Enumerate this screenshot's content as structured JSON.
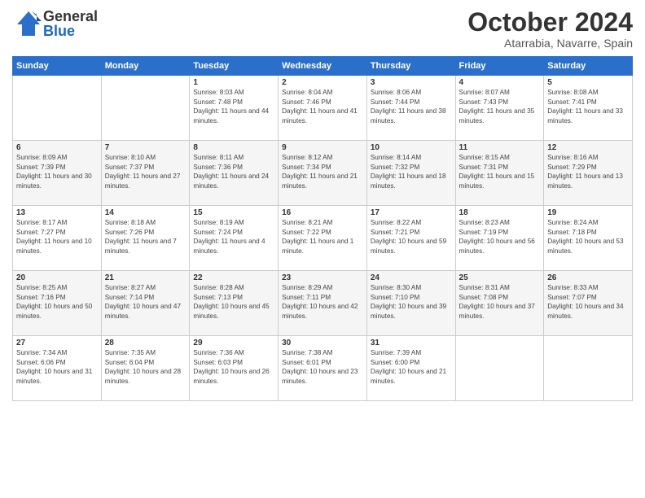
{
  "logo": {
    "general": "General",
    "blue": "Blue"
  },
  "title": {
    "month": "October 2024",
    "location": "Atarrabia, Navarre, Spain"
  },
  "headers": [
    "Sunday",
    "Monday",
    "Tuesday",
    "Wednesday",
    "Thursday",
    "Friday",
    "Saturday"
  ],
  "weeks": [
    [
      {
        "day": "",
        "info": ""
      },
      {
        "day": "",
        "info": ""
      },
      {
        "day": "1",
        "info": "Sunrise: 8:03 AM\nSunset: 7:48 PM\nDaylight: 11 hours and 44 minutes."
      },
      {
        "day": "2",
        "info": "Sunrise: 8:04 AM\nSunset: 7:46 PM\nDaylight: 11 hours and 41 minutes."
      },
      {
        "day": "3",
        "info": "Sunrise: 8:06 AM\nSunset: 7:44 PM\nDaylight: 11 hours and 38 minutes."
      },
      {
        "day": "4",
        "info": "Sunrise: 8:07 AM\nSunset: 7:43 PM\nDaylight: 11 hours and 35 minutes."
      },
      {
        "day": "5",
        "info": "Sunrise: 8:08 AM\nSunset: 7:41 PM\nDaylight: 11 hours and 33 minutes."
      }
    ],
    [
      {
        "day": "6",
        "info": "Sunrise: 8:09 AM\nSunset: 7:39 PM\nDaylight: 11 hours and 30 minutes."
      },
      {
        "day": "7",
        "info": "Sunrise: 8:10 AM\nSunset: 7:37 PM\nDaylight: 11 hours and 27 minutes."
      },
      {
        "day": "8",
        "info": "Sunrise: 8:11 AM\nSunset: 7:36 PM\nDaylight: 11 hours and 24 minutes."
      },
      {
        "day": "9",
        "info": "Sunrise: 8:12 AM\nSunset: 7:34 PM\nDaylight: 11 hours and 21 minutes."
      },
      {
        "day": "10",
        "info": "Sunrise: 8:14 AM\nSunset: 7:32 PM\nDaylight: 11 hours and 18 minutes."
      },
      {
        "day": "11",
        "info": "Sunrise: 8:15 AM\nSunset: 7:31 PM\nDaylight: 11 hours and 15 minutes."
      },
      {
        "day": "12",
        "info": "Sunrise: 8:16 AM\nSunset: 7:29 PM\nDaylight: 11 hours and 13 minutes."
      }
    ],
    [
      {
        "day": "13",
        "info": "Sunrise: 8:17 AM\nSunset: 7:27 PM\nDaylight: 11 hours and 10 minutes."
      },
      {
        "day": "14",
        "info": "Sunrise: 8:18 AM\nSunset: 7:26 PM\nDaylight: 11 hours and 7 minutes."
      },
      {
        "day": "15",
        "info": "Sunrise: 8:19 AM\nSunset: 7:24 PM\nDaylight: 11 hours and 4 minutes."
      },
      {
        "day": "16",
        "info": "Sunrise: 8:21 AM\nSunset: 7:22 PM\nDaylight: 11 hours and 1 minute."
      },
      {
        "day": "17",
        "info": "Sunrise: 8:22 AM\nSunset: 7:21 PM\nDaylight: 10 hours and 59 minutes."
      },
      {
        "day": "18",
        "info": "Sunrise: 8:23 AM\nSunset: 7:19 PM\nDaylight: 10 hours and 56 minutes."
      },
      {
        "day": "19",
        "info": "Sunrise: 8:24 AM\nSunset: 7:18 PM\nDaylight: 10 hours and 53 minutes."
      }
    ],
    [
      {
        "day": "20",
        "info": "Sunrise: 8:25 AM\nSunset: 7:16 PM\nDaylight: 10 hours and 50 minutes."
      },
      {
        "day": "21",
        "info": "Sunrise: 8:27 AM\nSunset: 7:14 PM\nDaylight: 10 hours and 47 minutes."
      },
      {
        "day": "22",
        "info": "Sunrise: 8:28 AM\nSunset: 7:13 PM\nDaylight: 10 hours and 45 minutes."
      },
      {
        "day": "23",
        "info": "Sunrise: 8:29 AM\nSunset: 7:11 PM\nDaylight: 10 hours and 42 minutes."
      },
      {
        "day": "24",
        "info": "Sunrise: 8:30 AM\nSunset: 7:10 PM\nDaylight: 10 hours and 39 minutes."
      },
      {
        "day": "25",
        "info": "Sunrise: 8:31 AM\nSunset: 7:08 PM\nDaylight: 10 hours and 37 minutes."
      },
      {
        "day": "26",
        "info": "Sunrise: 8:33 AM\nSunset: 7:07 PM\nDaylight: 10 hours and 34 minutes."
      }
    ],
    [
      {
        "day": "27",
        "info": "Sunrise: 7:34 AM\nSunset: 6:06 PM\nDaylight: 10 hours and 31 minutes."
      },
      {
        "day": "28",
        "info": "Sunrise: 7:35 AM\nSunset: 6:04 PM\nDaylight: 10 hours and 28 minutes."
      },
      {
        "day": "29",
        "info": "Sunrise: 7:36 AM\nSunset: 6:03 PM\nDaylight: 10 hours and 26 minutes."
      },
      {
        "day": "30",
        "info": "Sunrise: 7:38 AM\nSunset: 6:01 PM\nDaylight: 10 hours and 23 minutes."
      },
      {
        "day": "31",
        "info": "Sunrise: 7:39 AM\nSunset: 6:00 PM\nDaylight: 10 hours and 21 minutes."
      },
      {
        "day": "",
        "info": ""
      },
      {
        "day": "",
        "info": ""
      }
    ]
  ]
}
